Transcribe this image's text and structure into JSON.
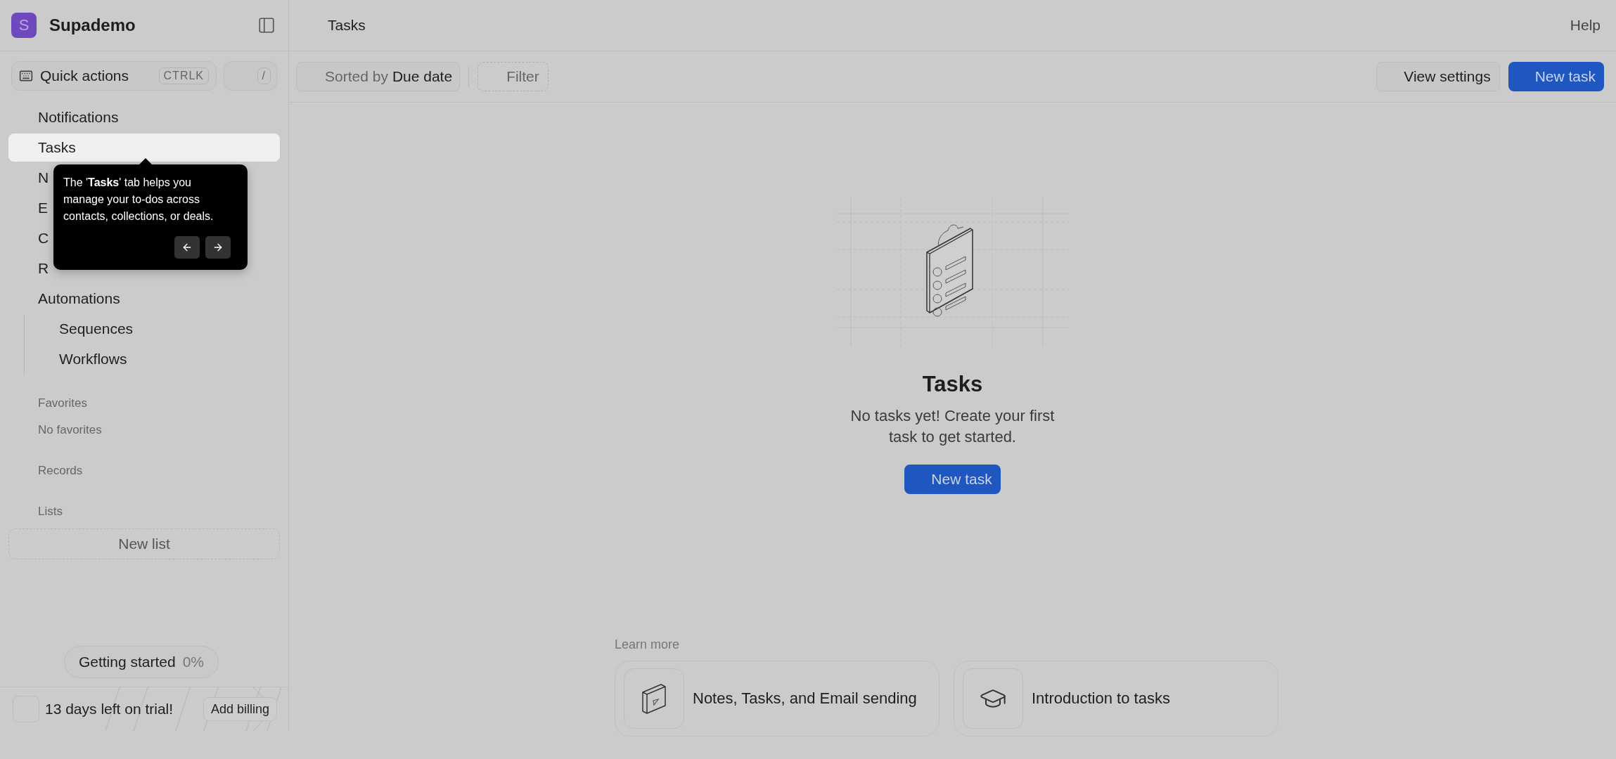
{
  "sidebar": {
    "workspace": {
      "initial": "S",
      "name": "Supademo"
    },
    "quick_actions": {
      "label": "Quick actions",
      "shortcut": "CTRLK",
      "slash_key": "/"
    },
    "nav": [
      {
        "label": "Notifications",
        "selected": false
      },
      {
        "label": "Tasks",
        "selected": true
      },
      {
        "label": "N",
        "selected": false
      },
      {
        "label": "E",
        "selected": false
      },
      {
        "label": "C",
        "selected": false
      },
      {
        "label": "R",
        "selected": false
      },
      {
        "label": "Automations",
        "selected": false,
        "children": [
          {
            "label": "Sequences",
            "selected": false
          },
          {
            "label": "Workflows",
            "selected": false
          }
        ]
      }
    ],
    "favorites": {
      "heading": "Favorites",
      "empty_text": "No favorites"
    },
    "records": {
      "heading": "Records"
    },
    "lists": {
      "heading": "Lists",
      "new_button": "New list"
    },
    "getting_started": {
      "label": "Getting started",
      "percent": "0%"
    },
    "trial": {
      "text": "13 days left on trial!",
      "button": "Add billing"
    }
  },
  "tooltip": {
    "text": "The '**Tasks**' tab helps you manage your to-dos across contacts, collections, or deals."
  },
  "header": {
    "title": "Tasks",
    "help": "Help"
  },
  "toolbar": {
    "sort": {
      "label": "Sorted by",
      "value": "Due date"
    },
    "filter": "Filter",
    "view_settings": "View settings",
    "new_task": "New task"
  },
  "empty_state": {
    "title": "Tasks",
    "description": "No tasks yet! Create your first task to get started.",
    "button": "New task"
  },
  "learn_more": {
    "heading": "Learn more",
    "cards": [
      {
        "kind": "video",
        "title": "Notes, Tasks, and Email sending"
      },
      {
        "kind": "course",
        "title": "Introduction to tasks"
      }
    ]
  }
}
